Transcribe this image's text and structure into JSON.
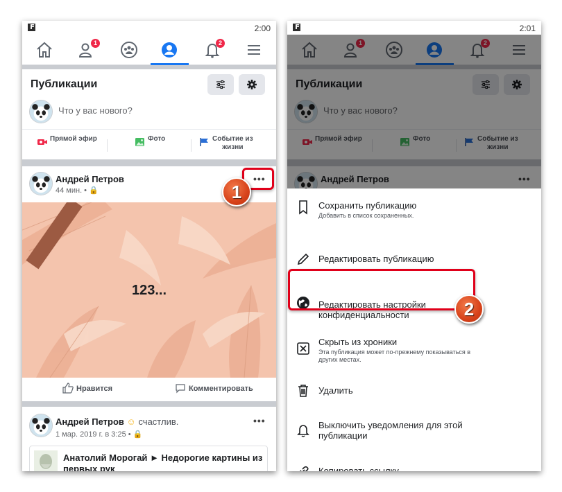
{
  "left_screen": {
    "status_time": "2:00",
    "status_icon": "F",
    "nav": {
      "friends_badge": "1",
      "notifications_badge": "2"
    },
    "page_title": "Публикации",
    "composer_placeholder": "Что у вас нового?",
    "actions": {
      "live": "Прямой эфир",
      "photo": "Фото",
      "event_line1": "Событие из",
      "event_line2": "жизни"
    },
    "post": {
      "author": "Андрей Петров",
      "meta": "44 мин. •",
      "more": "•••",
      "image_text": "123...",
      "like": "Нравится",
      "comment": "Комментировать"
    },
    "post2": {
      "author": "Андрей Петров",
      "feeling": "счастлив.",
      "meta": "1 мар. 2019 г. в 3:25 •",
      "more": "•••",
      "shared_author": "Анатолий Морогай",
      "shared_rest": "► Недорогие картины из первых рук"
    },
    "callout_number": "1"
  },
  "right_screen": {
    "status_time": "2:01",
    "status_icon": "F",
    "nav": {
      "friends_badge": "1",
      "notifications_badge": "2"
    },
    "page_title": "Публикации",
    "composer_placeholder": "Что у вас нового?",
    "actions": {
      "live": "Прямой эфир",
      "photo": "Фото",
      "event_line1": "Событие из",
      "event_line2": "жизни"
    },
    "post_author": "Андрей Петров",
    "more": "•••",
    "menu": {
      "save_title": "Сохранить публикацию",
      "save_sub": "Добавить в список сохраненных.",
      "edit": "Редактировать публикацию",
      "privacy_line1": "Редактировать настройки",
      "privacy_line2": "конфиденциальности",
      "hide_title": "Скрыть из хроники",
      "hide_sub_line1": "Эта публикация может по-прежнему показываться в",
      "hide_sub_line2": "других местах.",
      "delete": "Удалить",
      "notify_line1": "Выключить уведомления для этой",
      "notify_line2": "публикации",
      "copy_link": "Копировать ссылку"
    },
    "callout_number": "2"
  },
  "colors": {
    "facebook_blue": "#1877f2",
    "badge_red": "#f02849",
    "callout_red": "#e0001a",
    "callout_orange": "#d7421a",
    "image_peach": "#f3c2ab"
  }
}
